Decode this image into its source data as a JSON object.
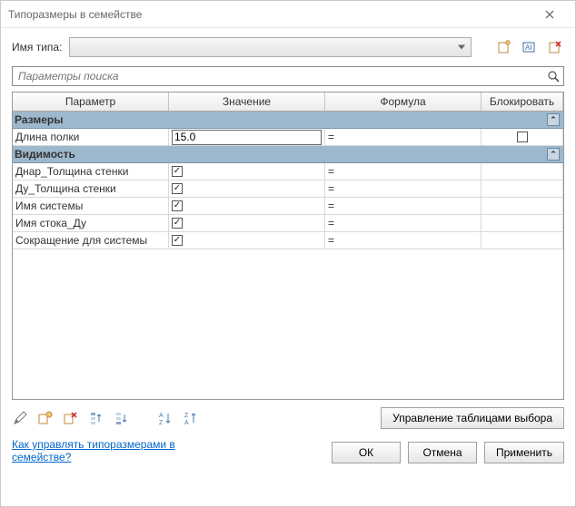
{
  "window": {
    "title": "Типоразмеры в семействе"
  },
  "typeRow": {
    "label": "Имя типа:",
    "value": ""
  },
  "search": {
    "placeholder": "Параметры поиска"
  },
  "columns": {
    "param": "Параметр",
    "value": "Значение",
    "formula": "Формула",
    "lock": "Блокировать"
  },
  "groups": [
    {
      "title": "Размеры",
      "rows": [
        {
          "param": "Длина полки",
          "value": "15.0",
          "valueType": "text",
          "formula": "=",
          "lock": false
        }
      ]
    },
    {
      "title": "Видимость",
      "rows": [
        {
          "param": "Днар_Толщина стенки",
          "value": true,
          "valueType": "check",
          "formula": "=",
          "lock": null
        },
        {
          "param": "Ду_Толщина стенки",
          "value": true,
          "valueType": "check",
          "formula": "=",
          "lock": null
        },
        {
          "param": "Имя системы",
          "value": true,
          "valueType": "check",
          "formula": "=",
          "lock": null
        },
        {
          "param": "Имя стока_Ду",
          "value": true,
          "valueType": "check",
          "formula": "=",
          "lock": null
        },
        {
          "param": "Сокращение для системы",
          "value": true,
          "valueType": "check",
          "formula": "=",
          "lock": null
        }
      ]
    }
  ],
  "buttons": {
    "lookupTables": "Управление таблицами выбора",
    "ok": "ОК",
    "cancel": "Отмена",
    "apply": "Применить"
  },
  "help": {
    "text": "Как управлять типоразмерами в семействе?"
  },
  "icons": {
    "newType": "new-type-icon",
    "renameType": "rename-type-icon",
    "deleteType": "delete-type-icon",
    "edit": "pencil-icon",
    "newParam": "new-param-icon",
    "deleteParam": "delete-param-icon",
    "moveUp": "move-up-icon",
    "moveDown": "move-down-icon",
    "sortAsc": "sort-asc-icon",
    "sortDesc": "sort-desc-icon"
  }
}
